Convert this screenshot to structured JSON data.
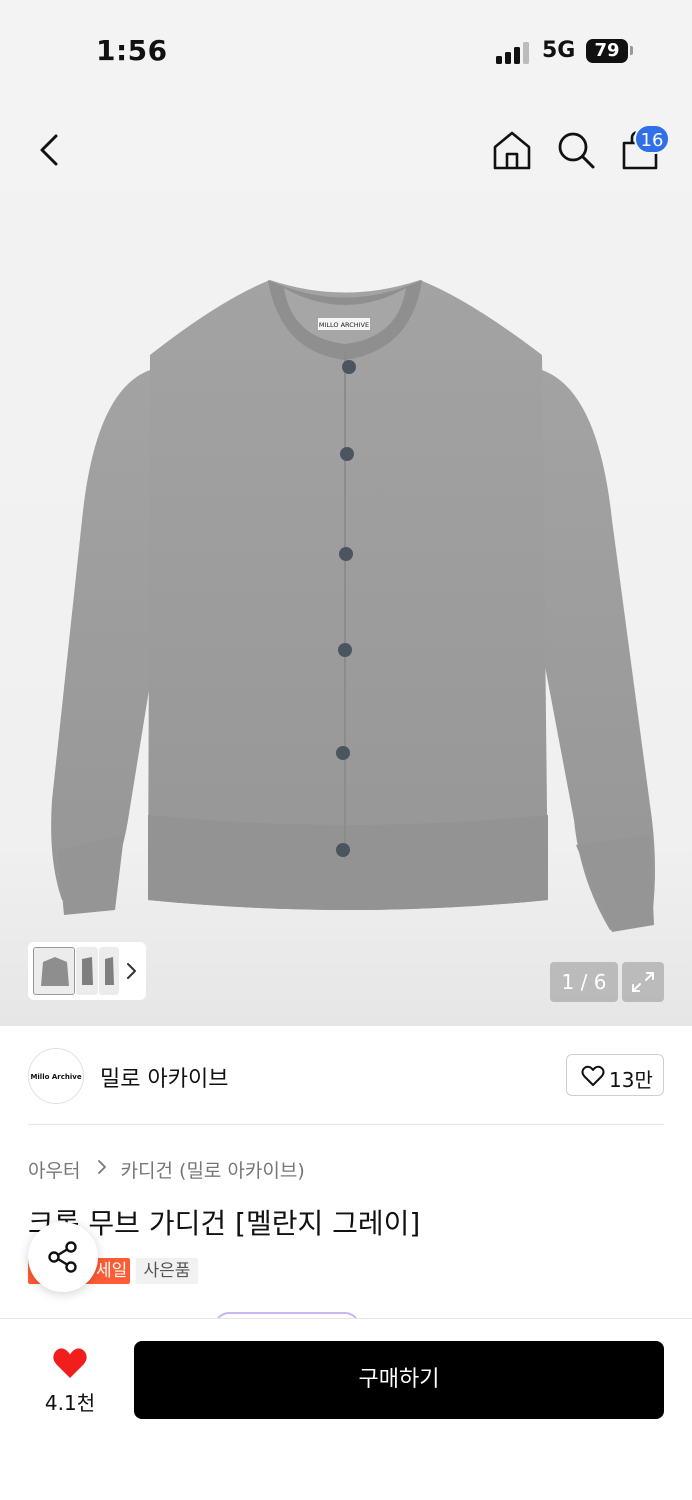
{
  "status_bar": {
    "time": "1:56",
    "network": "5G",
    "battery": "79"
  },
  "header": {
    "cart_badge": "16",
    "icons": [
      "back-icon",
      "home-icon",
      "search-icon",
      "shopping-bag-icon"
    ]
  },
  "gallery": {
    "page_indicator": "1 / 6",
    "current_page": 1,
    "total_pages": 6,
    "product_tag_text": "MILLO ARCHIVE",
    "colors": {
      "knit": "#9b9b9b",
      "button": "#4b5560"
    }
  },
  "brand": {
    "logo_text": "Millo Archive",
    "name": "밀로 아카이브",
    "like_count": "13만"
  },
  "product": {
    "breadcrumb": [
      "아우터",
      "카디건 (밀로 아카이브)"
    ],
    "title": "크롭 무브 가디건 [멜란지 그레이]",
    "tags": {
      "sale": "세일",
      "gift": "사은품"
    }
  },
  "bottom_bar": {
    "wish_count": "4.1천",
    "buy_label": "구매하기",
    "colors": {
      "heart": "#f21d1d",
      "buy_button": "#000000"
    }
  }
}
